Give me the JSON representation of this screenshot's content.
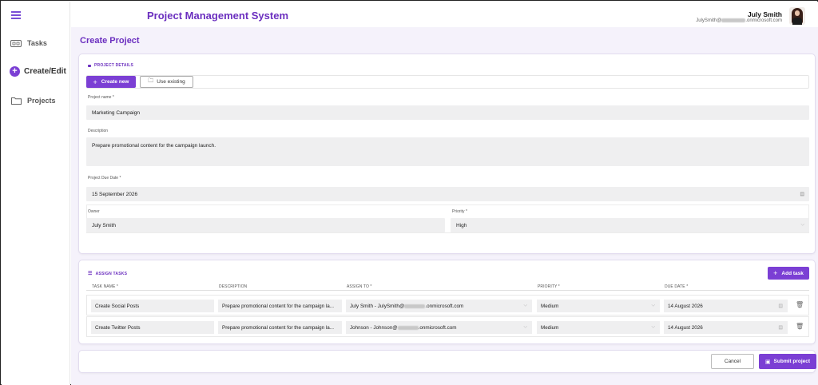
{
  "app": {
    "title": "Project Management System"
  },
  "user": {
    "name": "July Smith",
    "email_prefix": "JulySmith@",
    "email_suffix": ".onmicrosoft.com"
  },
  "sidebar": {
    "items": [
      {
        "label": "Tasks",
        "icon": "tasks-icon"
      },
      {
        "label": "Create/Edit",
        "icon": "plus-circle-icon",
        "active": true
      },
      {
        "label": "Projects",
        "icon": "folder-icon"
      }
    ]
  },
  "page": {
    "title": "Create Project"
  },
  "project_details": {
    "section_title": "PROJECT DETAILS",
    "create_new_label": "Create new",
    "use_existing_label": "Use existing",
    "name_label": "Project name *",
    "name_value": "Marketing Campaign",
    "description_label": "Description",
    "description_value": "Prepare promotional content for the campaign launch.",
    "due_date_label": "Project Due Date *",
    "due_date_value": "15 September 2026",
    "owner_label": "Owner",
    "owner_value": "July Smith",
    "priority_label": "Priority *",
    "priority_value": "High"
  },
  "assign_tasks": {
    "section_title": "ASSIGN TASKS",
    "add_task_label": "Add task",
    "columns": [
      "TASK NAME *",
      "DESCRIPTION",
      "ASSIGN TO *",
      "PRIORITY *",
      "DUE DATE *"
    ],
    "rows": [
      {
        "task_name": "Create Social Posts",
        "description": "Prepare promotional content for the campaign la...",
        "assign_to_prefix": "July Smith  -  JulySmith@",
        "assign_to_suffix": ".onmicrosoft.com",
        "priority": "Medium",
        "due_date": "14 August 2026"
      },
      {
        "task_name": "Create Twitter Posts",
        "description": "Prepare promotional content for the campaign la...",
        "assign_to_prefix": "Johnson  -  Johnson@",
        "assign_to_suffix": ".onmicrosoft.com",
        "priority": "Medium",
        "due_date": "14 August 2026"
      }
    ]
  },
  "footer": {
    "cancel_label": "Cancel",
    "submit_label": "Submit project"
  },
  "colors": {
    "accent": "#7b3fd4",
    "title": "#6b2fbf",
    "background": "#f5f2fb"
  }
}
